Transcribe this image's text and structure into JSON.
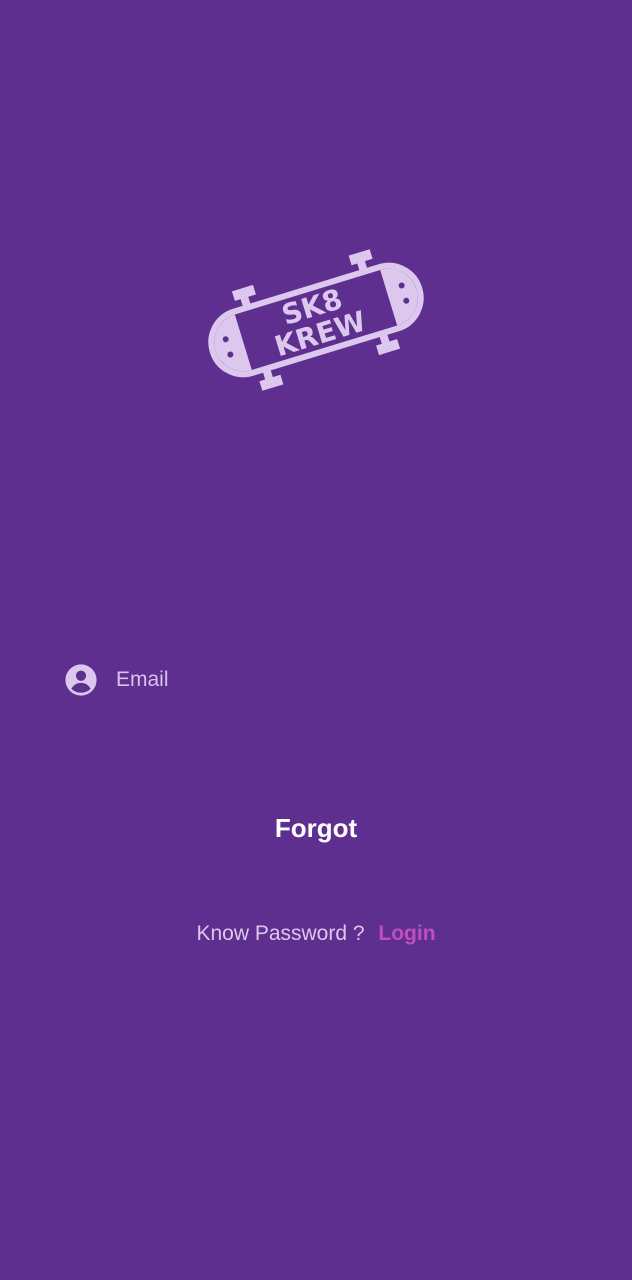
{
  "logo": {
    "line1": "SK8",
    "line2": "KREW",
    "color": "#dcc8ee"
  },
  "email_field": {
    "placeholder": "Email",
    "value": "",
    "icon": "account-circle-icon"
  },
  "forgot_button": {
    "label": "Forgot"
  },
  "footer": {
    "prompt": "Know Password ?",
    "login_label": "Login"
  },
  "colors": {
    "background": "#5f2f8f",
    "accent": "#c04ec0",
    "text_light": "#dcc8ee",
    "button_text": "#ffffff"
  }
}
